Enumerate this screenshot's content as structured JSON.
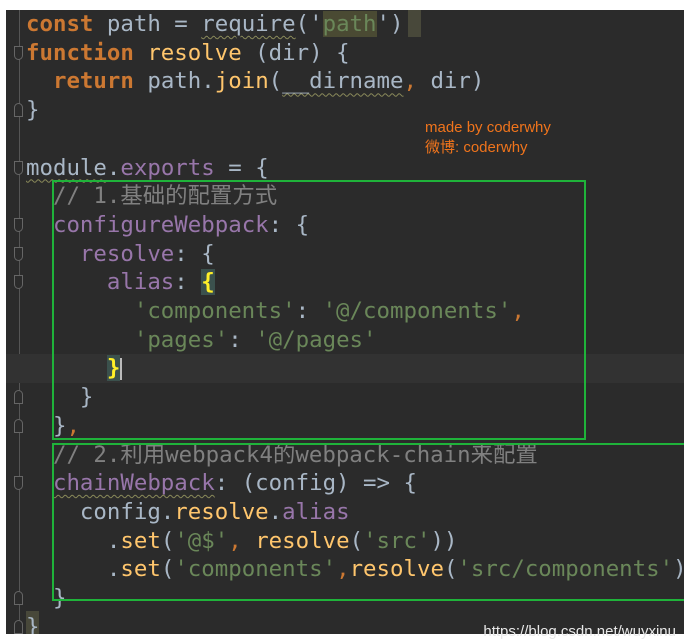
{
  "colors": {
    "background": "#2b2b2b",
    "keyword": "#cc7832",
    "string": "#6a8759",
    "property": "#9876aa",
    "function": "#ffc66d",
    "comment": "#808080",
    "box": "#1fb33a",
    "watermark": "#f0741c"
  },
  "watermark": {
    "line1": "made by coderwhy",
    "line2": "微博: coderwhy"
  },
  "url": "https://blog.csdn.net/wuyxinu",
  "code": [
    [
      [
        "const",
        "kw"
      ],
      [
        " path = ",
        "df"
      ],
      [
        "require",
        "df wavy"
      ],
      [
        "('",
        "df"
      ],
      [
        "path",
        "strhl"
      ],
      [
        "')",
        "df"
      ]
    ],
    [
      [
        "function",
        "kw"
      ],
      [
        " ",
        "df"
      ],
      [
        "resolve",
        "fn"
      ],
      [
        " (dir) {",
        "df"
      ]
    ],
    [
      [
        "  ",
        "df"
      ],
      [
        "return",
        "kw"
      ],
      [
        " path.",
        "df"
      ],
      [
        "join",
        "fn"
      ],
      [
        "(",
        "df"
      ],
      [
        "__dirname",
        "df wavy"
      ],
      [
        ",",
        "pn"
      ],
      [
        " dir)",
        "df"
      ]
    ],
    [
      [
        "}",
        "df"
      ]
    ],
    [],
    [
      [
        "module",
        "df wavy"
      ],
      [
        ".",
        "df"
      ],
      [
        "exports",
        "prop"
      ],
      [
        " = {",
        "df"
      ]
    ],
    [
      [
        "  // 1.基础的配置方式",
        "cm"
      ]
    ],
    [
      [
        "  ",
        "df"
      ],
      [
        "configureWebpack",
        "prop"
      ],
      [
        ": {",
        "df"
      ]
    ],
    [
      [
        "    ",
        "df"
      ],
      [
        "resolve",
        "prop"
      ],
      [
        ": {",
        "df"
      ]
    ],
    [
      [
        "      ",
        "df"
      ],
      [
        "alias",
        "prop"
      ],
      [
        ": ",
        "df"
      ],
      [
        "{",
        "brace"
      ]
    ],
    [
      [
        "        ",
        "df"
      ],
      [
        "'components'",
        "str"
      ],
      [
        ": ",
        "df"
      ],
      [
        "'@/components'",
        "str"
      ],
      [
        ",",
        "pn"
      ]
    ],
    [
      [
        "        ",
        "df"
      ],
      [
        "'pages'",
        "str"
      ],
      [
        ": ",
        "df"
      ],
      [
        "'@/pages'",
        "str"
      ]
    ],
    [
      [
        "      ",
        "df"
      ],
      [
        "}",
        "brace"
      ]
    ],
    [
      [
        "    }",
        "df"
      ]
    ],
    [
      [
        "  }",
        "df"
      ],
      [
        ",",
        "pn"
      ]
    ],
    [
      [
        "  // 2.利用webpack4的webpack-chain来配置",
        "cm"
      ]
    ],
    [
      [
        "  ",
        "df"
      ],
      [
        "chainWebpack",
        "prop wavy"
      ],
      [
        ": (config) => {",
        "df"
      ]
    ],
    [
      [
        "    config.",
        "df"
      ],
      [
        "resolve",
        "fn"
      ],
      [
        ".",
        "df"
      ],
      [
        "alias",
        "prop"
      ]
    ],
    [
      [
        "      .",
        "df"
      ],
      [
        "set",
        "fn"
      ],
      [
        "(",
        "df"
      ],
      [
        "'@$'",
        "str"
      ],
      [
        ",",
        "pn"
      ],
      [
        " ",
        "df"
      ],
      [
        "resolve",
        "fn"
      ],
      [
        "(",
        "df"
      ],
      [
        "'src'",
        "str"
      ],
      [
        "))",
        "df"
      ]
    ],
    [
      [
        "      .",
        "df"
      ],
      [
        "set",
        "fn"
      ],
      [
        "(",
        "df"
      ],
      [
        "'components'",
        "str"
      ],
      [
        ",",
        "pn"
      ],
      [
        "resolve",
        "fn"
      ],
      [
        "(",
        "df"
      ],
      [
        "'src/components'",
        "str"
      ],
      [
        "))",
        "df"
      ]
    ],
    [
      [
        "  }",
        "df"
      ]
    ],
    [
      [
        "}",
        "df"
      ]
    ]
  ]
}
